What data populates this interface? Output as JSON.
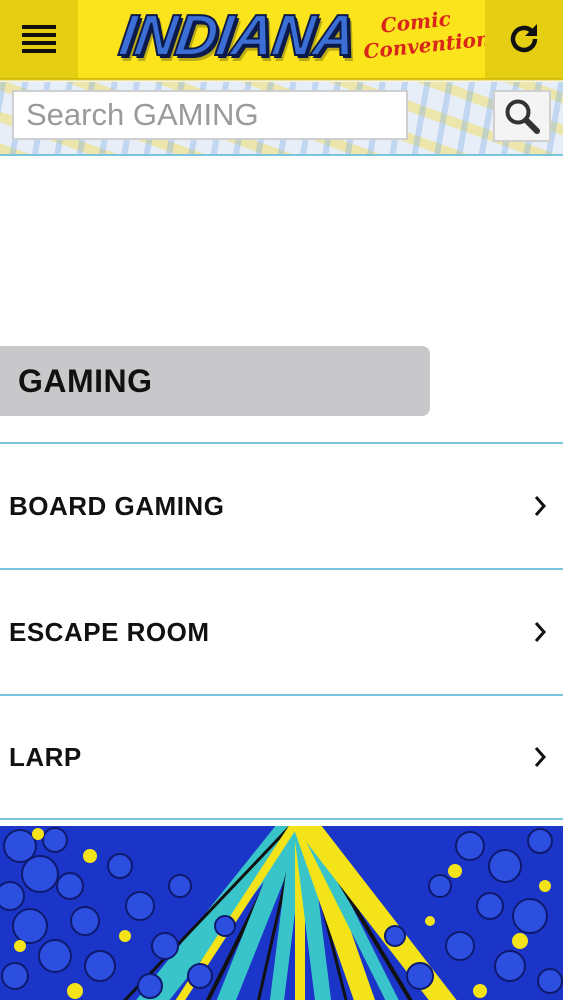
{
  "header": {
    "logo_main": "INDIANA",
    "logo_sub_line1": "Comic",
    "logo_sub_line2": "Convention",
    "menu_icon": "hamburger-menu-icon",
    "refresh_icon": "refresh-icon"
  },
  "search": {
    "placeholder": "Search GAMING",
    "button_icon": "search-icon"
  },
  "section": {
    "title": "GAMING"
  },
  "items": [
    {
      "label": "BOARD GAMING"
    },
    {
      "label": "ESCAPE ROOM"
    },
    {
      "label": "LARP"
    }
  ],
  "colors": {
    "header_yellow": "#fbe41b",
    "header_button": "#e6cf12",
    "divider_blue": "#7cc4dd",
    "section_gray": "#c8c7c9",
    "art_blue": "#1c35c9",
    "art_yellow": "#f5e31a",
    "art_cyan": "#38c4c8"
  }
}
